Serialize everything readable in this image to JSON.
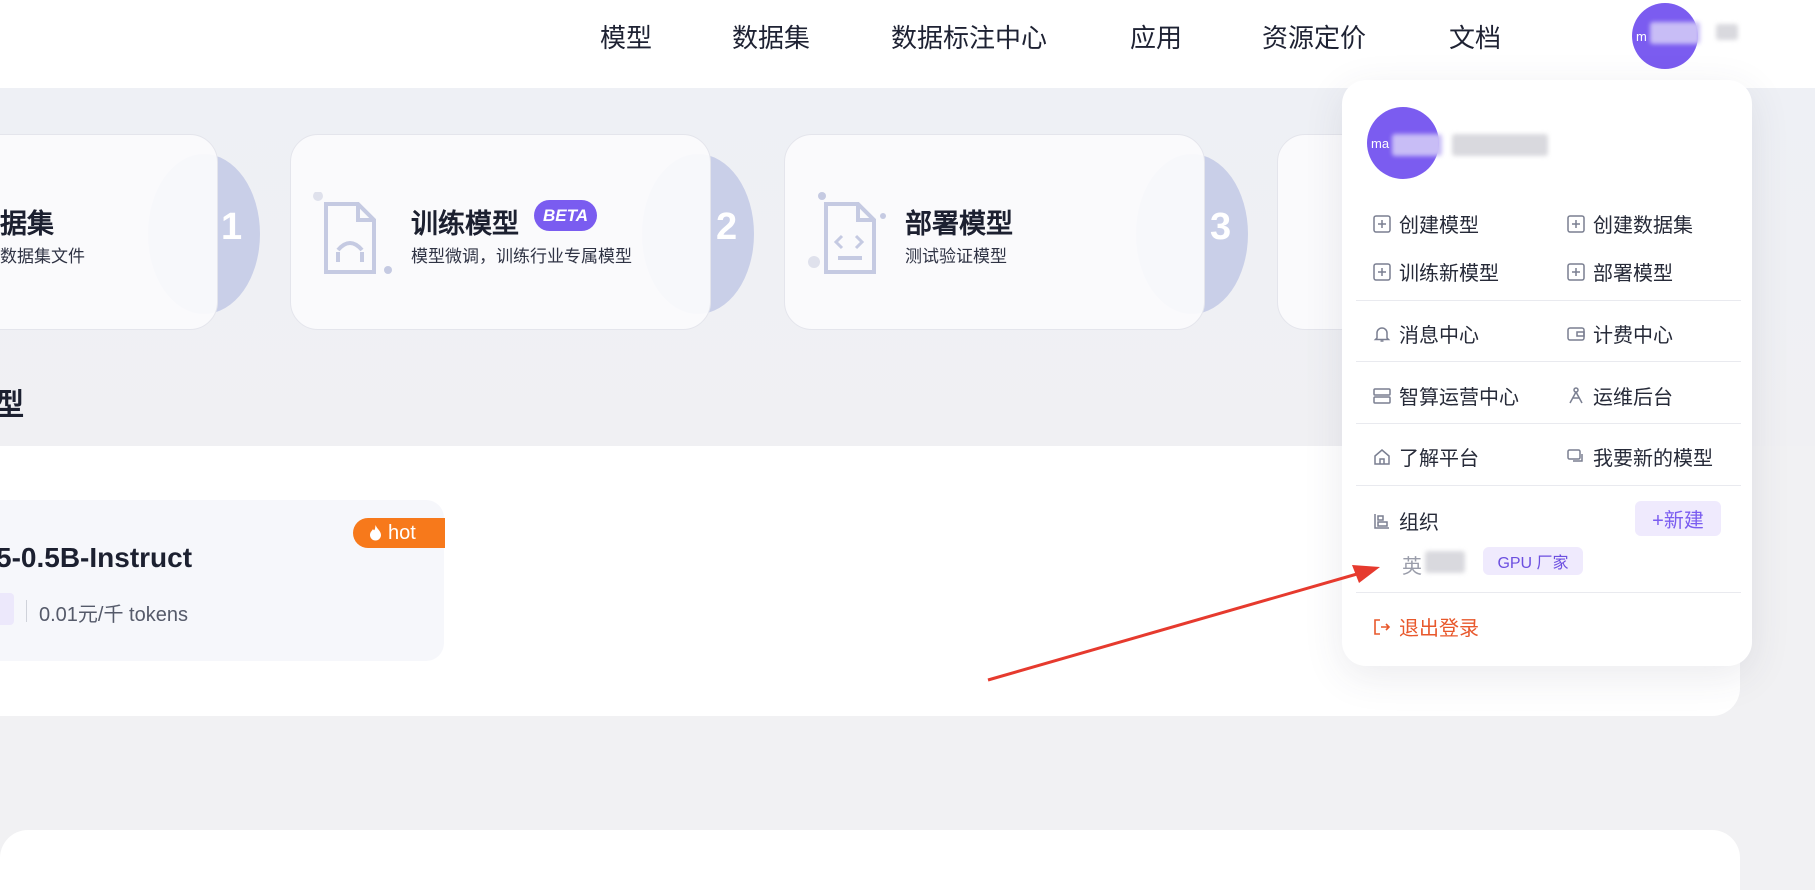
{
  "nav": {
    "items": [
      "模型",
      "数据集",
      "数据标注中心",
      "应用",
      "资源定价",
      "文档"
    ]
  },
  "user": {
    "avatar_text": "m"
  },
  "steps": [
    {
      "title": "据集",
      "sub": "数据集文件",
      "num": "1"
    },
    {
      "title": "训练模型",
      "badge": "BETA",
      "sub": "模型微调，训练行业专属模型",
      "num": "2"
    },
    {
      "title": "部署模型",
      "sub": "测试验证模型",
      "num": "3"
    }
  ],
  "section": {
    "title": "型"
  },
  "model_card": {
    "name": "5-0.5B-Instruct",
    "hot": "hot",
    "price": "0.01元/千 tokens"
  },
  "menu": {
    "avatar_text": "ma",
    "quick_actions": [
      "创建模型",
      "创建数据集",
      "训练新模型",
      "部署模型"
    ],
    "links": [
      "消息中心",
      "计费中心",
      "智算运营中心",
      "运维后台",
      "了解平台",
      "我要新的模型"
    ],
    "org_label": "组织",
    "new_button": "+新建",
    "org_name": "英",
    "org_tag": "GPU 厂家",
    "logout": "退出登录"
  },
  "colors": {
    "accent": "#7a5cf0",
    "hot": "#f7791b",
    "logout": "#e8582c",
    "annotation_arrow": "#e63a2e"
  }
}
